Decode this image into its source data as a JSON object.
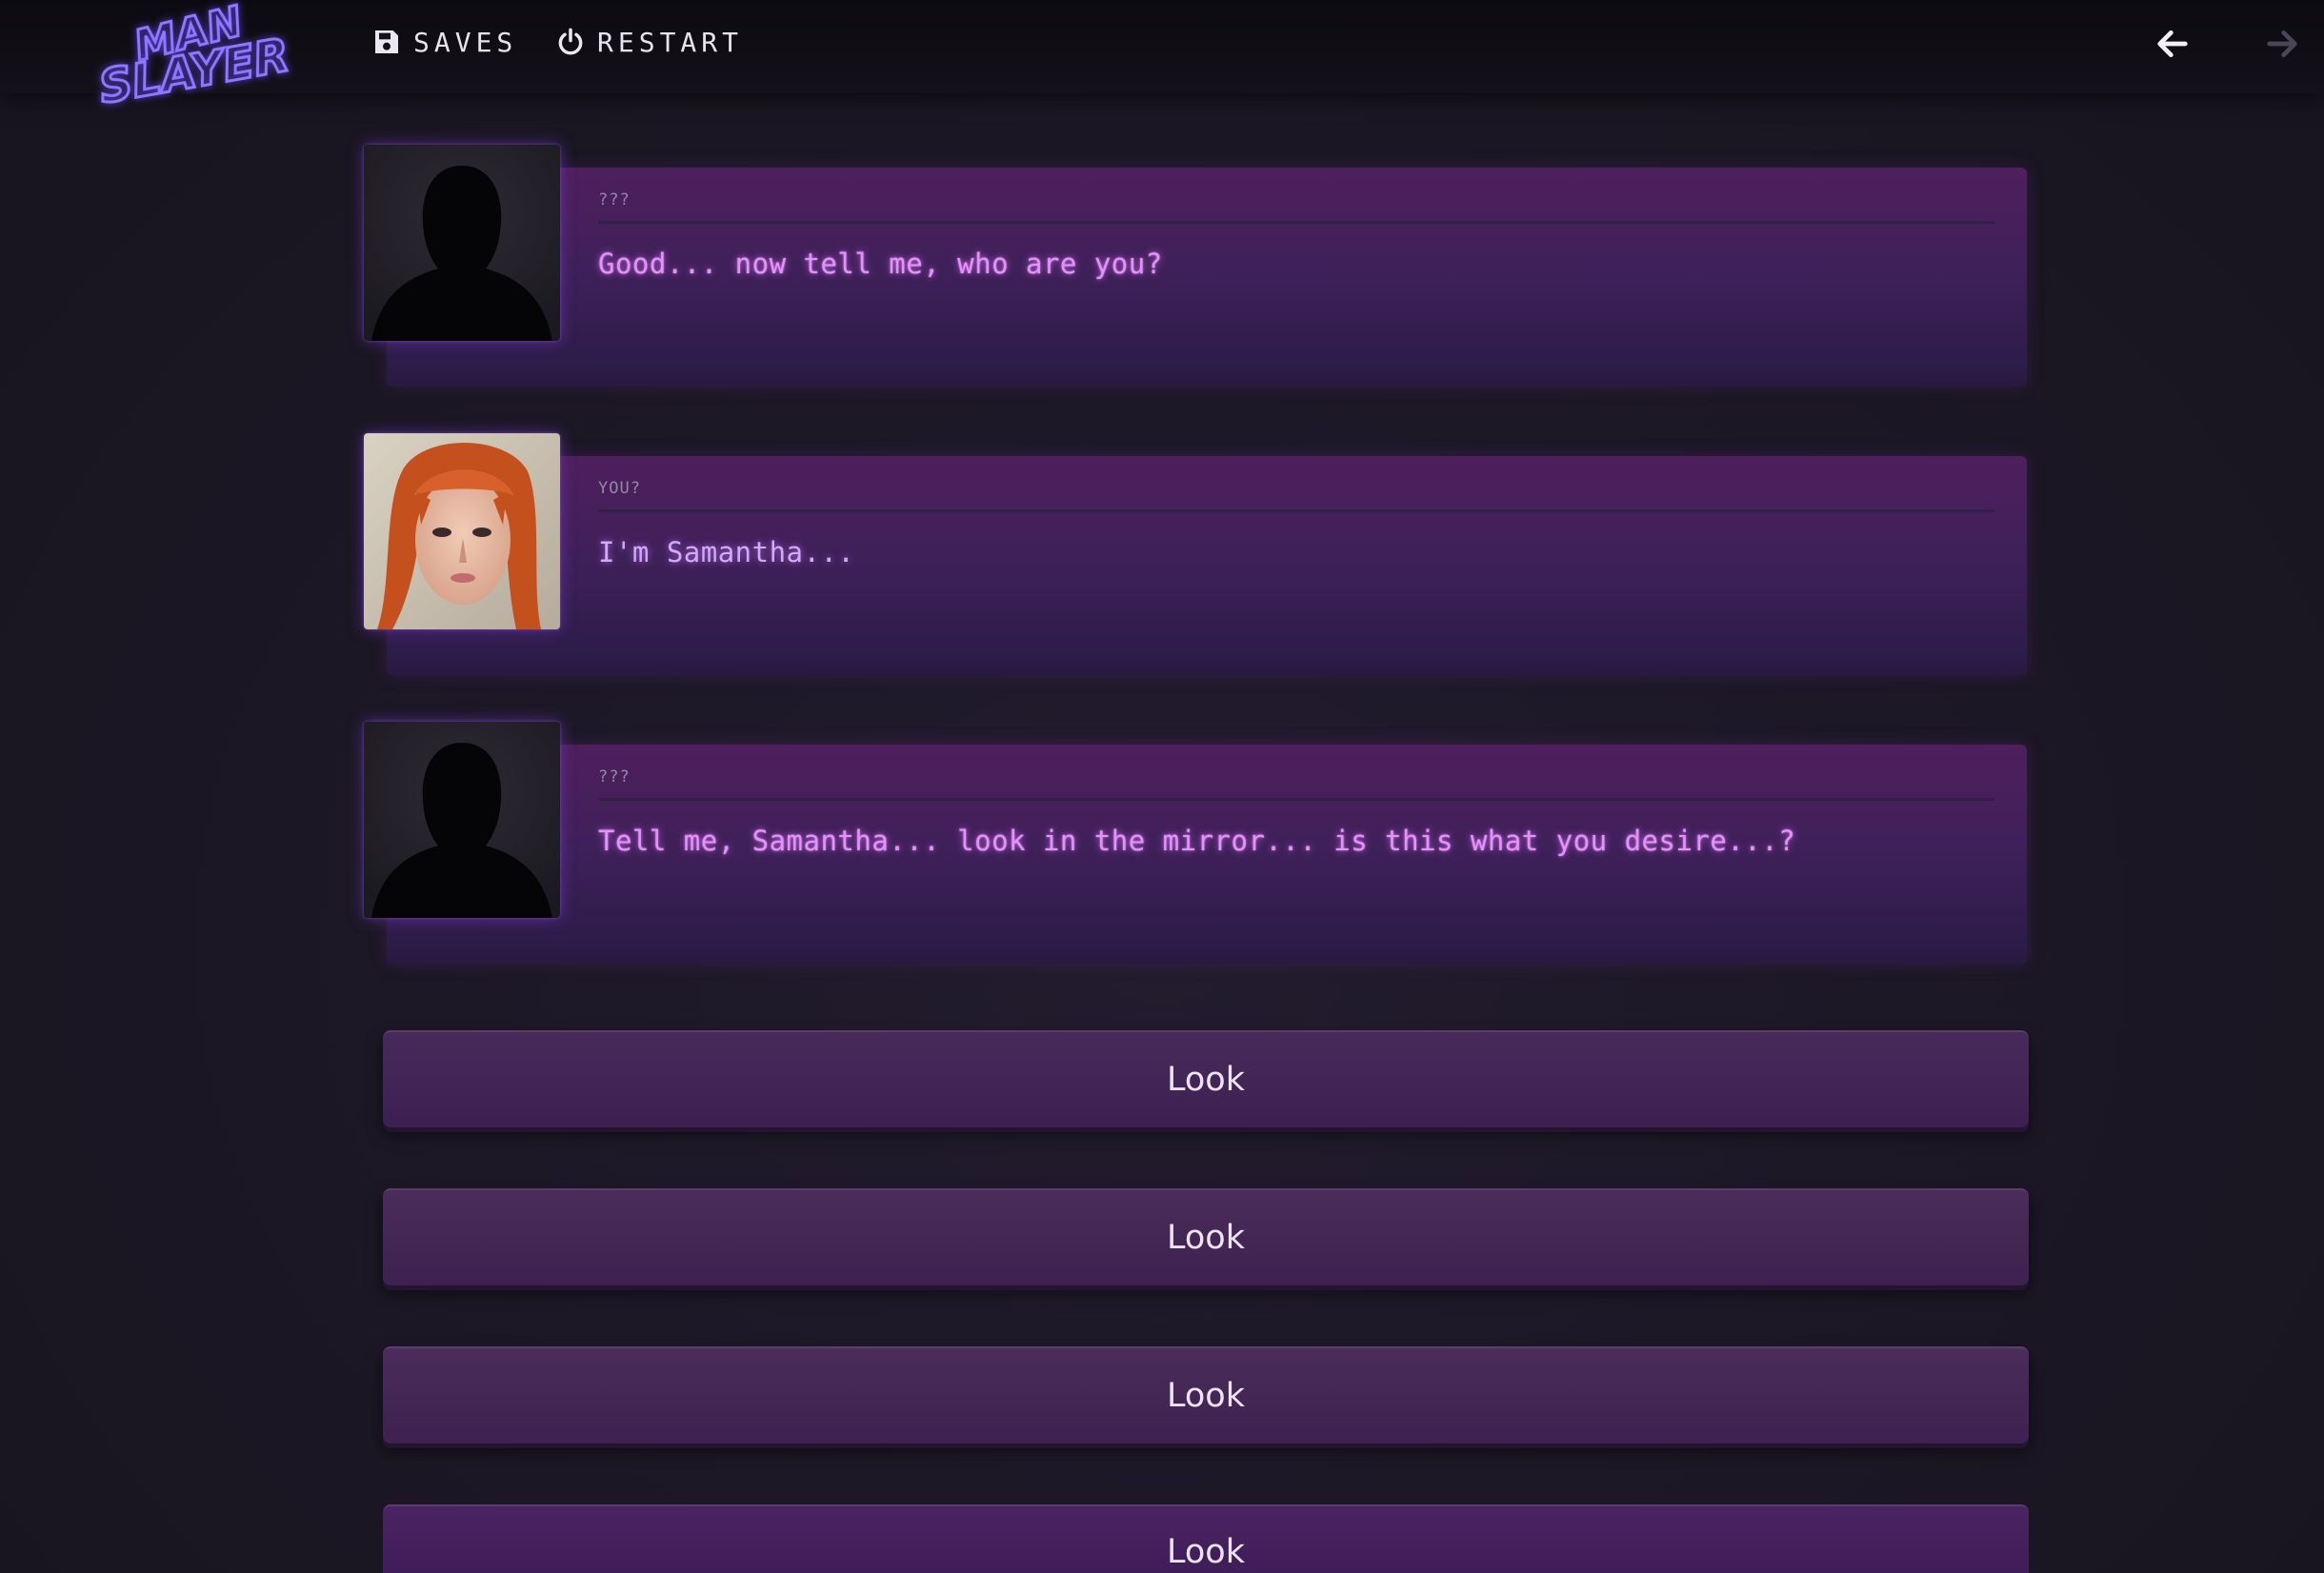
{
  "topbar": {
    "logo_line1": "MAN",
    "logo_line2": "SLAYER",
    "saves_label": "SAVES",
    "restart_label": "RESTART",
    "back_icon": "arrow-left-icon",
    "forward_icon": "arrow-right-icon"
  },
  "dialogue": [
    {
      "speaker": "???",
      "text": "Good... now tell me, who are you?",
      "portrait": "silhouette"
    },
    {
      "speaker": "YOU?",
      "text": "I'm Samantha...",
      "portrait": "red-haired-woman"
    },
    {
      "speaker": "???",
      "text": "Tell me, Samantha... look in the mirror... is this what you desire...?",
      "portrait": "silhouette"
    }
  ],
  "choices": [
    "Look",
    "Look",
    "Look",
    "Look"
  ],
  "colors": {
    "background": "#1c1826",
    "bubble": "#40205a",
    "dialogue_text": "#e68fff",
    "logo": "#8e78ff",
    "choice_button": "#452758"
  }
}
